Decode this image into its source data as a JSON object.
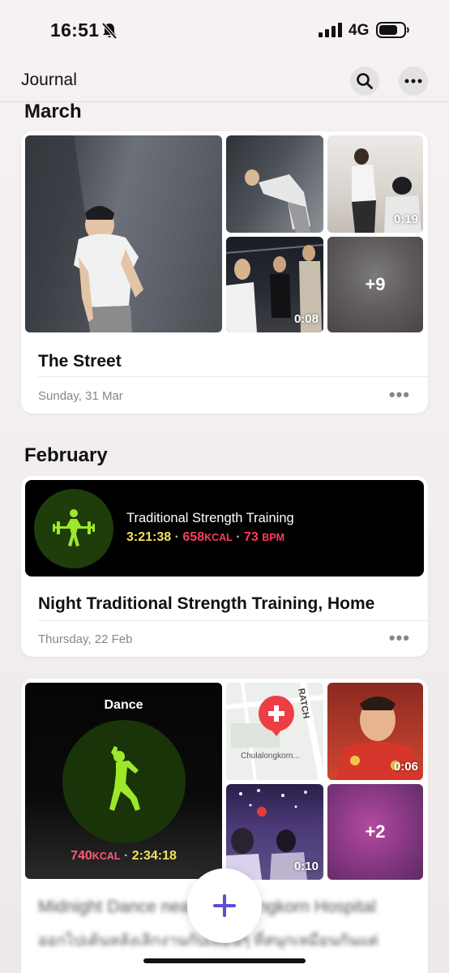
{
  "status_bar": {
    "time": "16:51",
    "network": "4G"
  },
  "nav": {
    "title": "Journal"
  },
  "sections": [
    {
      "month": "March"
    },
    {
      "month": "February"
    }
  ],
  "entry_street": {
    "title": "The Street",
    "date": "Sunday, 31 Mar",
    "media": {
      "video_a": "0:19",
      "video_b": "0:08",
      "more": "+9"
    }
  },
  "entry_workout": {
    "title": "Night Traditional Strength Training, Home",
    "date": "Thursday, 22 Feb",
    "workout_name": "Traditional Strength Training",
    "duration": "3:21:38",
    "calories": "658",
    "calories_unit": "KCAL",
    "heart_rate": "73",
    "heart_rate_unit": "BPM",
    "separator": "·"
  },
  "entry_dance": {
    "activity": "Dance",
    "calories": "740",
    "calories_unit": "KCAL",
    "duration": "2:34:18",
    "map_label": "Chulalongkorn...",
    "map_street": "RATCH",
    "media": {
      "video_a": "0:06",
      "video_b": "0:10",
      "more": "+2"
    },
    "title_blurred": "Midnight Dance near Chulalongkorn Hospital",
    "body_blurred": "ออกไปเต้นหลังเลิกงานกับเพื่อนๆ ที่สนุกเหมือนกันแต่"
  },
  "colors": {
    "accent": "#5b4fcf",
    "workout_green": "#9ee82a",
    "calorie_red": "#ff3b5c",
    "duration_yellow": "#f2e25c"
  }
}
